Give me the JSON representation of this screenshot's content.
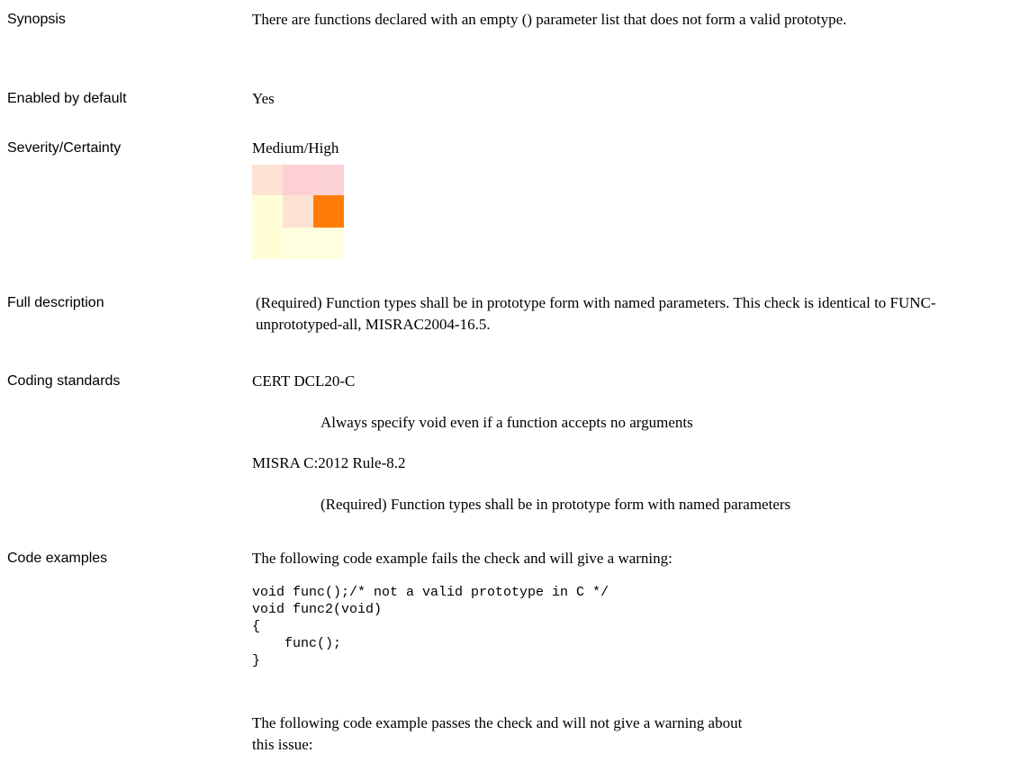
{
  "rows": {
    "synopsis": {
      "label": "Synopsis",
      "text": "There are functions declared with an empty () parameter list that does not form a valid prototype."
    },
    "enabled_by_default": {
      "label": "Enabled by default",
      "text": "Yes"
    },
    "severity_certainty": {
      "label": "Severity/Certainty",
      "text": "Medium/High",
      "matrix_colors": [
        "#fde3d3",
        "#fcd0d4",
        "#fcd2d6",
        "#fffed6",
        "#fde3d3",
        "#ff7d07",
        "#fffed6",
        "#fffede",
        "#fffede"
      ]
    },
    "full_description": {
      "label": "Full description",
      "text": "(Required) Function types shall be in prototype form with named parameters. This check is identical to FUNC-unprototyped-all, MISRAC2004-16.5."
    },
    "coding_standards": {
      "label": "Coding standards",
      "items": [
        {
          "name": "CERT DCL20-C",
          "description": "Always specify void even if a function accepts no arguments"
        },
        {
          "name": "MISRA C:2012 Rule-8.2",
          "description": "(Required) Function types shall be in prototype form with named parameters"
        }
      ]
    },
    "code_examples": {
      "label": "Code examples",
      "fail_intro": "The following code example fails the check and will give a warning:",
      "fail_code": "void func();/* not a valid prototype in C */\nvoid func2(void)\n{\n    func();\n}",
      "pass_intro": "The following code example passes the check and will not give a warning about this issue:"
    }
  }
}
